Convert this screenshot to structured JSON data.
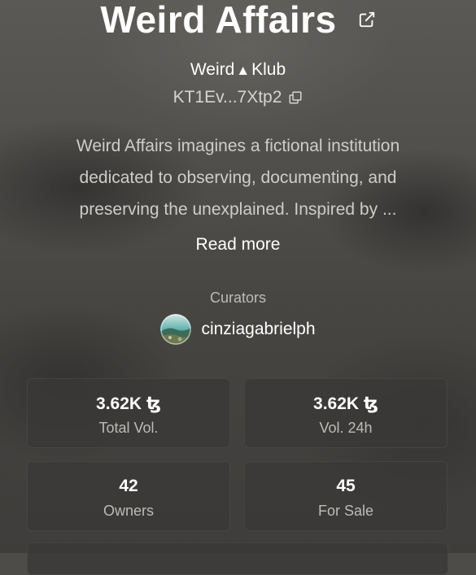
{
  "collection": {
    "title": "Weird Affairs",
    "creator_prefix": "Weird",
    "creator_triangle": "▲",
    "creator_suffix": "Klub",
    "contract": "KT1Ev...7Xtp2",
    "description_lines": [
      "Weird Affairs imagines a fictional institution",
      "dedicated to observing, documenting, and",
      "preserving the unexplained. Inspired by ..."
    ],
    "read_more": "Read more"
  },
  "curators": {
    "label": "Curators",
    "items": [
      {
        "name": "cinziagabrielph",
        "avatar_icon": "landscape-avatar"
      }
    ]
  },
  "stats": [
    {
      "value": "3.62K ꜩ",
      "label": "Total Vol."
    },
    {
      "value": "3.62K ꜩ",
      "label": "Vol. 24h"
    },
    {
      "value": "42",
      "label": "Owners"
    },
    {
      "value": "45",
      "label": "For Sale"
    }
  ],
  "icons": {
    "external": "external-link-icon",
    "copy": "copy-icon"
  },
  "colors": {
    "background": "#4e4c49",
    "card": "#3a3937",
    "muted_text": "#bdbbb7",
    "text": "#ffffff"
  }
}
